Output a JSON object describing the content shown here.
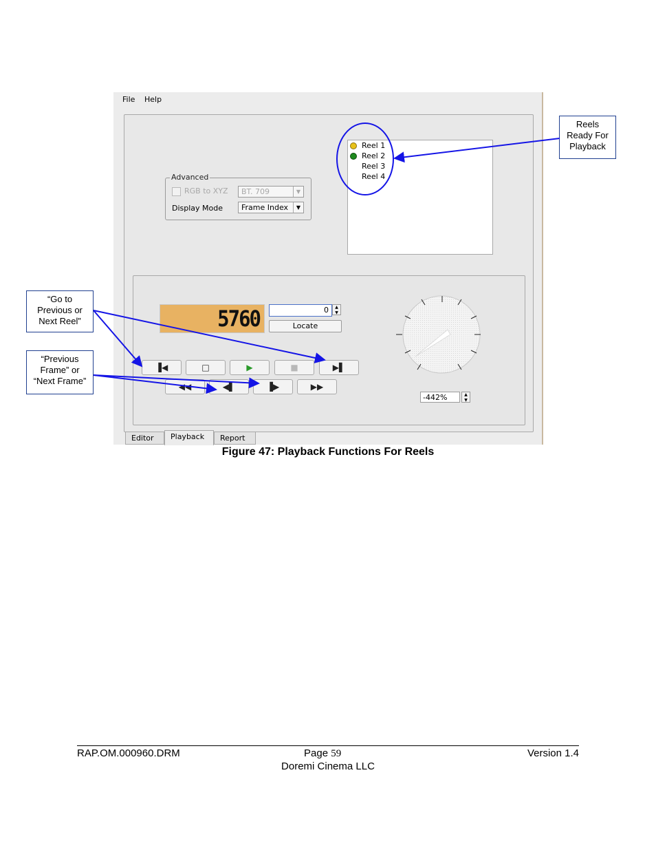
{
  "menu": {
    "file": "File",
    "help": "Help"
  },
  "advanced": {
    "legend": "Advanced",
    "rgb_label": "RGB to XYZ",
    "color_space": "BT. 709",
    "display_mode_label": "Display Mode",
    "display_mode": "Frame Index"
  },
  "reels": [
    {
      "label": "Reel 1",
      "status_color": "#e8c21a"
    },
    {
      "label": "Reel 2",
      "status_color": "#1e8a1e"
    },
    {
      "label": "Reel 3"
    },
    {
      "label": "Reel 4"
    }
  ],
  "playback": {
    "frame_display": "5760",
    "frame_input": "0",
    "locate_label": "Locate",
    "zoom": "-442%"
  },
  "transport_icons": {
    "prev_reel": "▐◀",
    "stop": "□",
    "play": "▶",
    "pause": "■",
    "next_reel": "▶▌",
    "rewind": "◀◀",
    "prev_frame": "◀▌",
    "next_frame": "▐▶",
    "fast_forward": "▶▶"
  },
  "tabs": [
    "Editor",
    "Playback",
    "Report"
  ],
  "callouts": {
    "reels_ready": [
      "Reels",
      "Ready For",
      "Playback"
    ],
    "go_reel": [
      "“Go to",
      "Previous or",
      "Next Reel”"
    ],
    "frame": [
      "“Previous",
      "Frame” or",
      "“Next Frame”"
    ]
  },
  "caption": "Figure 47: Playback Functions For Reels",
  "footer": {
    "doc_id": "RAP.OM.000960.DRM",
    "page_label": "Page",
    "page_number": "59",
    "version": "Version 1.4",
    "company": "Doremi Cinema LLC"
  },
  "colors": {
    "annotation_blue": "#1414e6",
    "frame_display_bg": "#e8b262",
    "play_green": "#2a9a2a"
  }
}
